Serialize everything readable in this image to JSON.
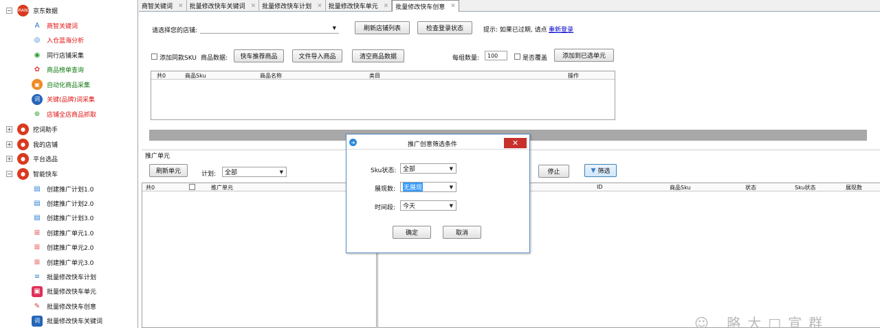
{
  "sidebar": {
    "categories": [
      {
        "label": "京东数据",
        "expander": "⊟",
        "icon_text": "BRAND",
        "icon_name": "jd-data-icon"
      },
      {
        "label": "挖词助手",
        "expander": "⊞",
        "icon_name": "word-helper-icon"
      },
      {
        "label": "我的店铺",
        "expander": "⊞",
        "icon_name": "my-shop-icon"
      },
      {
        "label": "平台选品",
        "expander": "⊞",
        "icon_name": "platform-select-icon"
      },
      {
        "label": "智能快车",
        "expander": "⊟",
        "icon_name": "smart-express-icon"
      }
    ],
    "jd_items": [
      {
        "label": "商智关键词",
        "color": "red",
        "glyph": "A",
        "icon_name": "font-icon"
      },
      {
        "label": "入仓蓝海分析",
        "color": "red",
        "glyph": "◎",
        "icon_name": "target-icon"
      },
      {
        "label": "同行店铺采集",
        "color": "black",
        "glyph": "◉",
        "icon_name": "eye-icon"
      },
      {
        "label": "商品榜单查询",
        "color": "green",
        "glyph": "✿",
        "icon_name": "ranking-icon"
      },
      {
        "label": "自动化商品采集",
        "color": "green",
        "glyph": "▣",
        "icon_name": "auto-collect-icon"
      },
      {
        "label": "关键(品牌)词采集",
        "color": "red",
        "glyph": "词",
        "icon_name": "keyword-icon"
      },
      {
        "label": "店铺全店商品抓取",
        "color": "red",
        "glyph": "⊕",
        "icon_name": "globe-search-icon"
      }
    ],
    "express_items": [
      {
        "label": "创建推广计划1.0",
        "glyph": "▤",
        "icon_name": "plan-doc-icon"
      },
      {
        "label": "创建推广计划2.0",
        "glyph": "▤",
        "icon_name": "plan-doc-icon"
      },
      {
        "label": "创建推广计划3.0",
        "glyph": "▤",
        "icon_name": "plan-doc-icon"
      },
      {
        "label": "创建推广单元1.0",
        "glyph": "⊞",
        "icon_name": "unit-grid-icon"
      },
      {
        "label": "创建推广单元2.0",
        "glyph": "⊞",
        "icon_name": "unit-grid-icon"
      },
      {
        "label": "创建推广单元3.0",
        "glyph": "⊞",
        "icon_name": "unit-grid-icon"
      },
      {
        "label": "批量修改快车计划",
        "glyph": "≡",
        "icon_name": "batch-plan-icon"
      },
      {
        "label": "批量修改快车单元",
        "glyph": "▣",
        "icon_name": "batch-unit-icon"
      },
      {
        "label": "批量修改快车创意",
        "glyph": "✎",
        "icon_name": "batch-creative-icon"
      },
      {
        "label": "批量修改快车关键词",
        "glyph": "词",
        "icon_name": "batch-keyword-icon"
      }
    ]
  },
  "tabs": [
    {
      "label": "商智关键词",
      "active": false
    },
    {
      "label": "批量修改快车关键词",
      "active": false
    },
    {
      "label": "批量修改快车计划",
      "active": false
    },
    {
      "label": "批量修改快车单元",
      "active": false
    },
    {
      "label": "批量修改快车创意",
      "active": true
    }
  ],
  "toolbar": {
    "shop_label": "请选择您的店铺:",
    "refresh_shops": "刷新店铺列表",
    "check_login": "检查登录状态",
    "hint_prefix": "提示: 如果已过期, 请点",
    "hint_link": "重新登录"
  },
  "products": {
    "add_same_sku": "添加同款SKU",
    "product_data_label": "商品数据:",
    "express_recommend": "快车推荐商品",
    "file_import": "文件导入商品",
    "clear_data": "清空商品数据",
    "group_count_label": "每组数量:",
    "group_count_value": "100",
    "override_label": "是否覆盖",
    "add_to_unit": "添加到已选单元",
    "columns": [
      "共0",
      "商品Sku",
      "商品名称",
      "类目",
      "操作"
    ]
  },
  "units": {
    "section_label": "推广单元",
    "refresh_units": "刷新单元",
    "plan_label": "计划:",
    "plan_value": "全部",
    "stop": "停止",
    "filter": "筛选",
    "left_columns": [
      "共0",
      "推广单元"
    ],
    "right_columns": [
      "ID",
      "商品Sku",
      "状态",
      "Sku状态",
      "展现数"
    ]
  },
  "dialog": {
    "title": "推广创意筛选条件",
    "close": "✕",
    "sku_status_label": "Sku状态:",
    "sku_status_value": "全部",
    "impression_label": "展现数:",
    "impression_value": "无展现",
    "period_label": "时间段:",
    "period_value": "今天",
    "confirm": "确定",
    "cancel": "取消"
  },
  "watermark": "☺ 略大□宣群"
}
